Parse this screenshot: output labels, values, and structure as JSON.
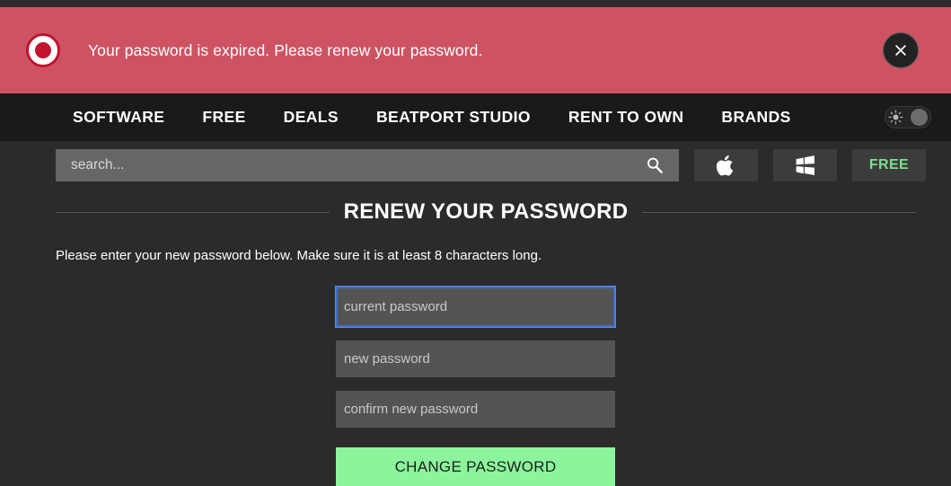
{
  "alert": {
    "message": "Your password is expired. Please renew your password.",
    "icon": "error-circle-icon",
    "close_label": "✕",
    "background_color": "#cd5363"
  },
  "nav": {
    "items": [
      {
        "label": "SOFTWARE"
      },
      {
        "label": "FREE"
      },
      {
        "label": "DEALS"
      },
      {
        "label": "BEATPORT STUDIO"
      },
      {
        "label": "RENT TO OWN"
      },
      {
        "label": "BRANDS"
      }
    ],
    "theme_toggle": {
      "icon": "sun-icon",
      "state": "off"
    }
  },
  "search": {
    "value": "",
    "placeholder": "search...",
    "icon": "search-icon"
  },
  "filters": [
    {
      "name": "apple-filter",
      "icon": "apple-icon",
      "label": ""
    },
    {
      "name": "windows-filter",
      "icon": "windows-icon",
      "label": ""
    },
    {
      "name": "free-filter",
      "icon": "",
      "label": "FREE",
      "color": "#7ae08d"
    }
  ],
  "main": {
    "heading": "RENEW YOUR PASSWORD",
    "instruction": "Please enter your new password below. Make sure it is at least 8 characters long.",
    "fields": [
      {
        "name": "current-password-field",
        "placeholder": "current password",
        "value": "",
        "focused": true
      },
      {
        "name": "new-password-field",
        "placeholder": "new password",
        "value": "",
        "focused": false
      },
      {
        "name": "confirm-password-field",
        "placeholder": "confirm new password",
        "value": "",
        "focused": false
      }
    ],
    "submit_label": "CHANGE PASSWORD",
    "submit_color": "#8cf49c"
  }
}
